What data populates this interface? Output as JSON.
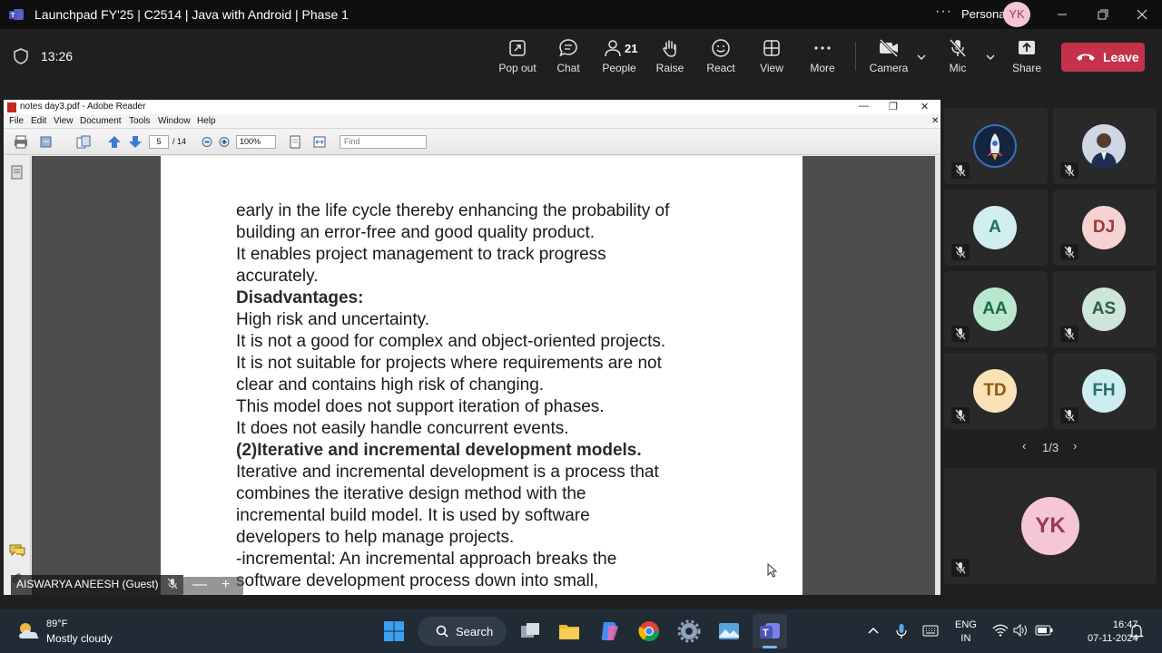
{
  "window": {
    "title": "Launchpad FY'25 | C2514 | Java with Android | Phase 1",
    "account_label": "Personal",
    "account_initials": "YK",
    "more_glyph": "···"
  },
  "meeting": {
    "elapsed": "13:26",
    "buttons": {
      "popout": "Pop out",
      "chat": "Chat",
      "people": "People",
      "people_count": "21",
      "raise": "Raise",
      "react": "React",
      "view": "View",
      "more": "More",
      "camera": "Camera",
      "mic": "Mic",
      "share": "Share",
      "leave": "Leave"
    },
    "leave_color": "#c4314b"
  },
  "reader": {
    "title": "notes day3.pdf - Adobe Reader",
    "menu": [
      "File",
      "Edit",
      "View",
      "Document",
      "Tools",
      "Window",
      "Help"
    ],
    "page_current": "5",
    "page_total": "/ 14",
    "zoom": "100%",
    "find_placeholder": "Find",
    "lines": [
      {
        "text": "early in the life cycle thereby enhancing the probability of",
        "bold": false
      },
      {
        "text": "building an error-free and good quality product.",
        "bold": false
      },
      {
        "text": "It enables project management to track progress",
        "bold": false
      },
      {
        "text": "accurately.",
        "bold": false
      },
      {
        "text": "Disadvantages:",
        "bold": true
      },
      {
        "text": "High risk and uncertainty.",
        "bold": false
      },
      {
        "text": "It is not a good for complex and object-oriented projects.",
        "bold": false
      },
      {
        "text": "It is not suitable for projects where requirements are not",
        "bold": false
      },
      {
        "text": "clear and contains high risk of changing.",
        "bold": false
      },
      {
        "text": "This model does not support iteration of phases.",
        "bold": false
      },
      {
        "text": "It does not easily handle concurrent events.",
        "bold": false
      },
      {
        "text": "(2)Iterative and incremental development models.",
        "bold": true
      },
      {
        "text": "Iterative and incremental development is a process that",
        "bold": false
      },
      {
        "text": "combines the iterative design method with the",
        "bold": false
      },
      {
        "text": "incremental build model. It is used by software",
        "bold": false
      },
      {
        "text": "developers to help manage projects.",
        "bold": false
      },
      {
        "text": "-incremental: An incremental approach breaks the",
        "bold": false
      },
      {
        "text": "software development process down into small,",
        "bold": false
      }
    ]
  },
  "presenter": {
    "name": "AISWARYA ANEESH (Guest)",
    "zoom_minus": "—",
    "zoom_plus": "+"
  },
  "participants": [
    {
      "initials": "",
      "kind": "image-rocket",
      "bg": "#14253f",
      "fg": "#ffffff",
      "muted": true
    },
    {
      "initials": "",
      "kind": "image-person",
      "bg": "#cfd7e6",
      "fg": "#ffffff",
      "muted": true
    },
    {
      "initials": "A",
      "kind": "initials",
      "bg": "#cfeeed",
      "fg": "#1f6b68",
      "muted": true
    },
    {
      "initials": "DJ",
      "kind": "initials",
      "bg": "#f6d3d3",
      "fg": "#a03838",
      "muted": true
    },
    {
      "initials": "AA",
      "kind": "initials",
      "bg": "#b9e8cf",
      "fg": "#1d6a44",
      "muted": true
    },
    {
      "initials": "AS",
      "kind": "initials",
      "bg": "#cde6d9",
      "fg": "#2c5e47",
      "muted": true
    },
    {
      "initials": "TD",
      "kind": "initials",
      "bg": "#fbe2b6",
      "fg": "#8a5a10",
      "muted": true
    },
    {
      "initials": "FH",
      "kind": "initials",
      "bg": "#cdeef0",
      "fg": "#2a6c72",
      "muted": true
    }
  ],
  "pager": {
    "label": "1/3"
  },
  "self_view": {
    "initials": "YK",
    "muted": true
  },
  "taskbar": {
    "weather_temp": "89°F",
    "weather_desc": "Mostly cloudy",
    "search_label": "Search",
    "lang_top": "ENG",
    "lang_bottom": "IN",
    "time": "16:47",
    "date": "07-11-2024"
  }
}
